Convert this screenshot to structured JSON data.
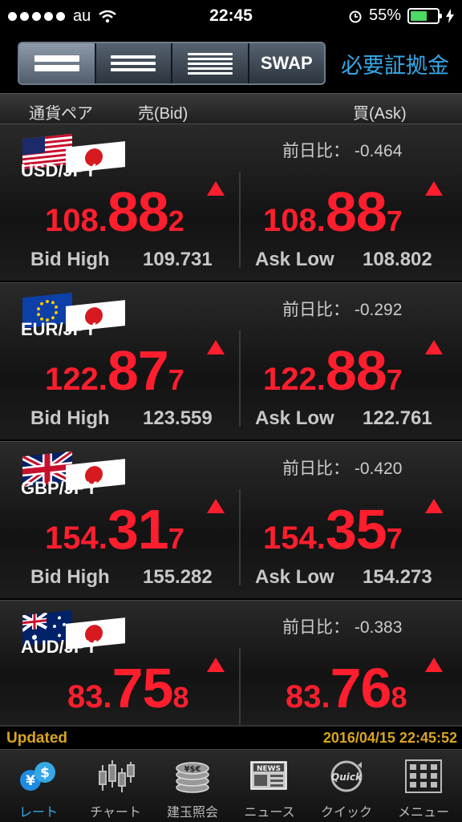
{
  "status_bar": {
    "carrier": "au",
    "time": "22:45",
    "battery": "55%"
  },
  "toolbar": {
    "segments": [
      {
        "label": ""
      },
      {
        "label": ""
      },
      {
        "label": ""
      },
      {
        "label": "SWAP"
      }
    ],
    "margin_link": "必要証拠金"
  },
  "columns": {
    "pair": "通貨ペア",
    "bid": "売(Bid)",
    "ask": "買(Ask)"
  },
  "pairs": [
    {
      "name": "USD/JPY",
      "diff": "前日比： -0.464",
      "bid": {
        "prefix": "108.",
        "big": "88",
        "pip": "2"
      },
      "ask": {
        "prefix": "108.",
        "big": "88",
        "pip": "7"
      },
      "bid_high_label": "Bid High",
      "bid_high": "109.731",
      "ask_low_label": "Ask Low",
      "ask_low": "108.802"
    },
    {
      "name": "EUR/JPY",
      "diff": "前日比： -0.292",
      "bid": {
        "prefix": "122.",
        "big": "87",
        "pip": "7"
      },
      "ask": {
        "prefix": "122.",
        "big": "88",
        "pip": "7"
      },
      "bid_high_label": "Bid High",
      "bid_high": "123.559",
      "ask_low_label": "Ask Low",
      "ask_low": "122.761"
    },
    {
      "name": "GBP/JPY",
      "diff": "前日比： -0.420",
      "bid": {
        "prefix": "154.",
        "big": "31",
        "pip": "7"
      },
      "ask": {
        "prefix": "154.",
        "big": "35",
        "pip": "7"
      },
      "bid_high_label": "Bid High",
      "bid_high": "155.282",
      "ask_low_label": "Ask Low",
      "ask_low": "154.273"
    },
    {
      "name": "AUD/JPY",
      "diff": "前日比： -0.383",
      "bid": {
        "prefix": "83.",
        "big": "75",
        "pip": "8"
      },
      "ask": {
        "prefix": "83.",
        "big": "76",
        "pip": "8"
      }
    }
  ],
  "updated": {
    "label": "Updated",
    "timestamp": "2016/04/15 22:45:52"
  },
  "tabs": [
    {
      "label": "レート",
      "icon": "rate-icon"
    },
    {
      "label": "チャート",
      "icon": "chart-icon"
    },
    {
      "label": "建玉照会",
      "icon": "position-icon"
    },
    {
      "label": "ニュース",
      "icon": "news-icon"
    },
    {
      "label": "クイック",
      "icon": "quick-icon"
    },
    {
      "label": "メニュー",
      "icon": "menu-icon"
    }
  ],
  "colors": {
    "price": "#ff1e2e",
    "accent": "#35a8e6",
    "updated": "#d9a520"
  }
}
